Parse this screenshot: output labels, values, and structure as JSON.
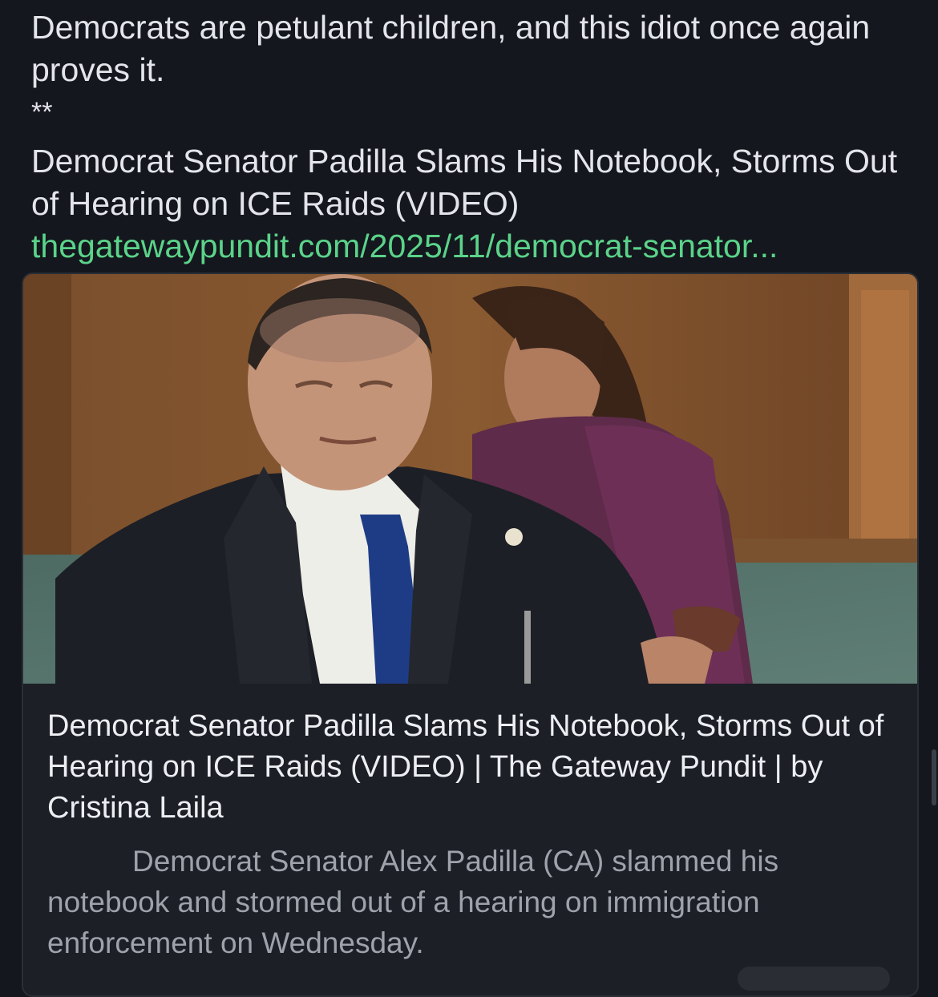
{
  "post": {
    "line1": "Democrats are petulant children, and this idiot once again proves it.",
    "separator": "**",
    "headline": "Democrat Senator Padilla Slams His Notebook, Storms Out of Hearing on ICE Raids (VIDEO)",
    "link_text": "thegatewaypundit.com/2025/11/democrat-senator..."
  },
  "link_card": {
    "image_alt": "Senator at hearing looking down at notebook",
    "title": "Democrat Senator Padilla Slams His Notebook, Storms Out of Hearing on ICE Raids (VIDEO) | The Gateway Pundit | by Cristina Laila",
    "description": "Democrat Senator Alex Padilla (CA) slammed his notebook and stormed out of a hearing on immigration enforcement on Wednesday."
  },
  "colors": {
    "background": "#14171d",
    "link": "#5bd38a",
    "card_background": "#1c1f26",
    "card_description": "#9ea2ab"
  }
}
